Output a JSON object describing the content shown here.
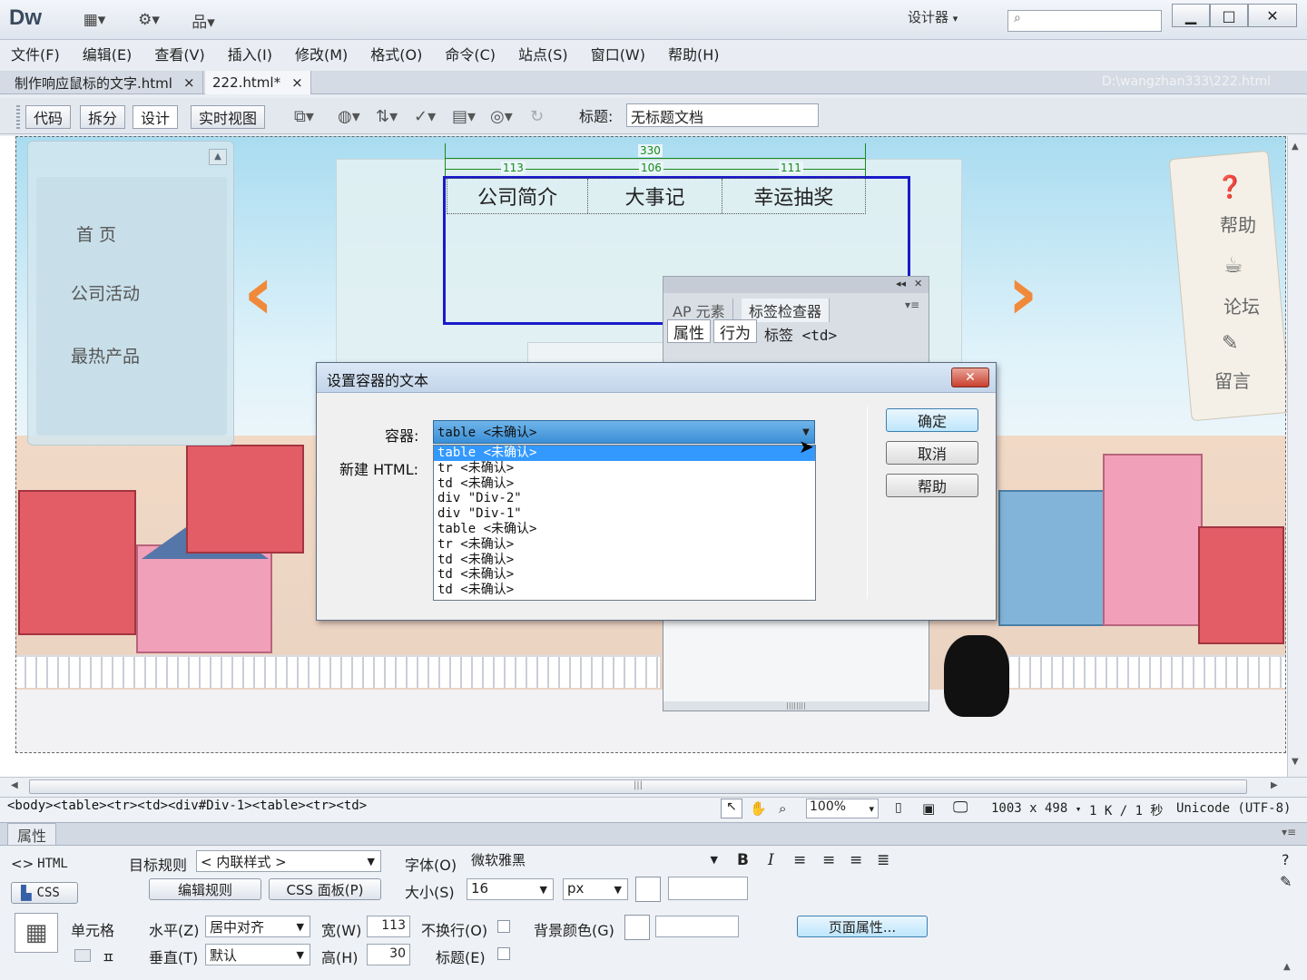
{
  "app": {
    "logo": "Dw",
    "workspace": "设计器",
    "search_placeholder": "",
    "window_buttons": {
      "minimize": "▁",
      "maximize": "□",
      "close": "✕"
    }
  },
  "menubar": {
    "items": [
      "文件(F)",
      "编辑(E)",
      "查看(V)",
      "插入(I)",
      "修改(M)",
      "格式(O)",
      "命令(C)",
      "站点(S)",
      "窗口(W)",
      "帮助(H)"
    ]
  },
  "doc_tabs": [
    {
      "label": "制作响应鼠标的文字.html",
      "close": "×"
    },
    {
      "label": "222.html*",
      "close": "×"
    }
  ],
  "doc_path": "D:\\wangzhan333\\222.html",
  "doc_toolbar": {
    "views": [
      "代码",
      "拆分",
      "设计",
      "实时视图"
    ],
    "title_label": "标题:",
    "title_value": "无标题文档"
  },
  "page": {
    "side_menu": [
      "首 页",
      "公司活动",
      "最热产品"
    ],
    "nav_cells": [
      "公司简介",
      "大事记",
      "幸运抽奖"
    ],
    "dims": {
      "total": "330",
      "col1": "113",
      "col2": "106",
      "col3": "111"
    },
    "help_tag": [
      "帮助",
      "论坛",
      "留言"
    ],
    "arrow_left": "‹",
    "arrow_right": "›"
  },
  "tag_inspector": {
    "tabs": [
      "AP 元素",
      "标签检查器"
    ],
    "sub_tabs": [
      "属性",
      "行为"
    ],
    "tag_label": "标签 <td>"
  },
  "dialog": {
    "title": "设置容器的文本",
    "container_label": "容器:",
    "html_label": "新建 HTML:",
    "selected": "table <未确认>",
    "options": [
      "table <未确认>",
      "tr <未确认>",
      "td <未确认>",
      "div \"Div-2\"",
      "div \"Div-1\"",
      "table <未确认>",
      "tr <未确认>",
      "td <未确认>",
      "td <未确认>",
      "td <未确认>"
    ],
    "buttons": {
      "ok": "确定",
      "cancel": "取消",
      "help": "帮助"
    }
  },
  "status": {
    "tag_selector": "<body><table><tr><td><div#Div-1><table><tr><td>",
    "zoom": "100%",
    "doc_size": "1003 x 498",
    "size_info": "1 K / 1 秒",
    "encoding": "Unicode (UTF-8)"
  },
  "properties": {
    "header": "属性",
    "html_btn": "HTML",
    "css_btn": "CSS",
    "target_rule_label": "目标规则",
    "target_rule_value": "< 内联样式 >",
    "edit_rule_btn": "编辑规则",
    "css_panel_btn": "CSS 面板(P)",
    "font_label": "字体(O)",
    "font_value": "微软雅黑",
    "size_label": "大小(S)",
    "size_value": "16",
    "unit_value": "px",
    "cell_label": "单元格",
    "horz_label": "水平(Z)",
    "horz_value": "居中对齐",
    "vert_label": "垂直(T)",
    "vert_value": "默认",
    "width_label": "宽(W)",
    "width_value": "113",
    "height_label": "高(H)",
    "height_value": "30",
    "nowrap_label": "不换行(O)",
    "header_label": "标题(E)",
    "bg_label": "背景颜色(G)",
    "page_props_btn": "页面属性...",
    "merge_label": "ㅍ"
  },
  "colors": {
    "accent_blue": "#1a1acb",
    "selection": "#3399ff",
    "arrow_orange": "#f08a3a",
    "dim_green": "#1a8a1a"
  }
}
